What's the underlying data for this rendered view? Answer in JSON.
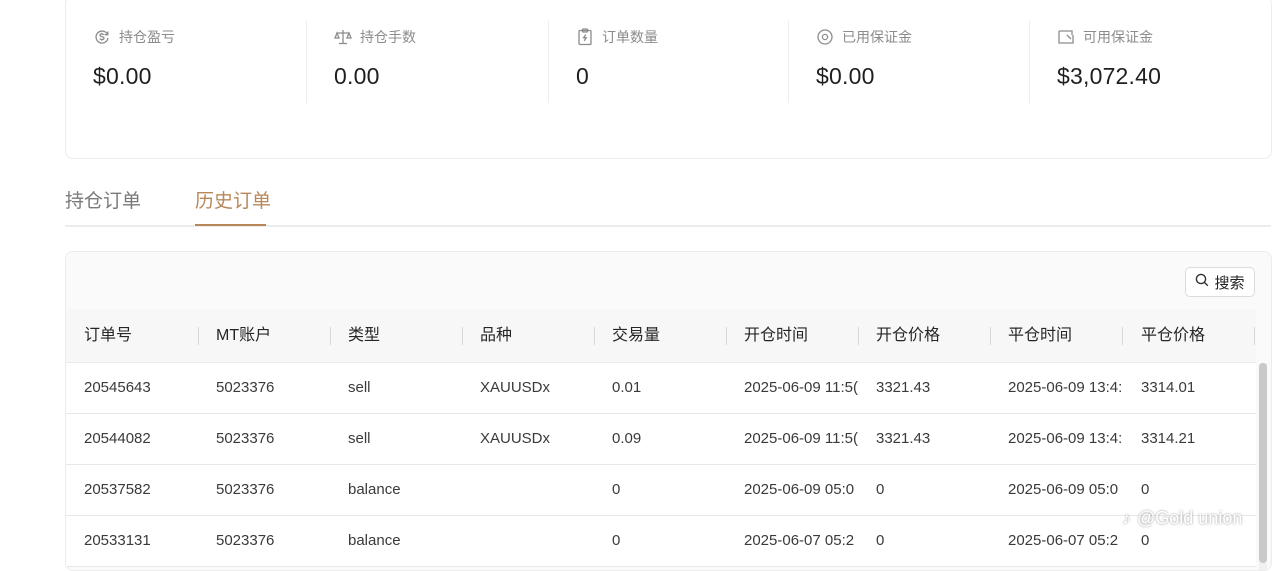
{
  "stats": [
    {
      "label": "持仓盈亏",
      "value": "$0.00",
      "icon": "dollar-cycle-icon"
    },
    {
      "label": "持仓手数",
      "value": "0.00",
      "icon": "scale-icon"
    },
    {
      "label": "订单数量",
      "value": "0",
      "icon": "clipboard-icon"
    },
    {
      "label": "已用保证金",
      "value": "$0.00",
      "icon": "coin-icon"
    },
    {
      "label": "可用保证金",
      "value": "$3,072.40",
      "icon": "wallet-icon"
    }
  ],
  "tabs": {
    "open_orders": "持仓订单",
    "history_orders": "历史订单",
    "active": "历史订单"
  },
  "toolbar": {
    "search_label": "搜索"
  },
  "table": {
    "headers": [
      "订单号",
      "MT账户",
      "类型",
      "品种",
      "交易量",
      "开仓时间",
      "开仓价格",
      "平仓时间",
      "平仓价格"
    ],
    "rows": [
      [
        "20545643",
        "5023376",
        "sell",
        "XAUUSDx",
        "0.01",
        "2025-06-09 11:5(",
        "3321.43",
        "2025-06-09 13:4:",
        "3314.01"
      ],
      [
        "20544082",
        "5023376",
        "sell",
        "XAUUSDx",
        "0.09",
        "2025-06-09 11:5(",
        "3321.43",
        "2025-06-09 13:4:",
        "3314.21"
      ],
      [
        "20537582",
        "5023376",
        "balance",
        "",
        "0",
        "2025-06-09 05:0",
        "0",
        "2025-06-09 05:0",
        "0"
      ],
      [
        "20533131",
        "5023376",
        "balance",
        "",
        "0",
        "2025-06-07 05:2",
        "0",
        "2025-06-07 05:2",
        "0"
      ]
    ]
  },
  "watermark": "@Gold union",
  "colors": {
    "accent": "#b8885a",
    "border": "#ececec",
    "label": "#8c8c8c"
  }
}
